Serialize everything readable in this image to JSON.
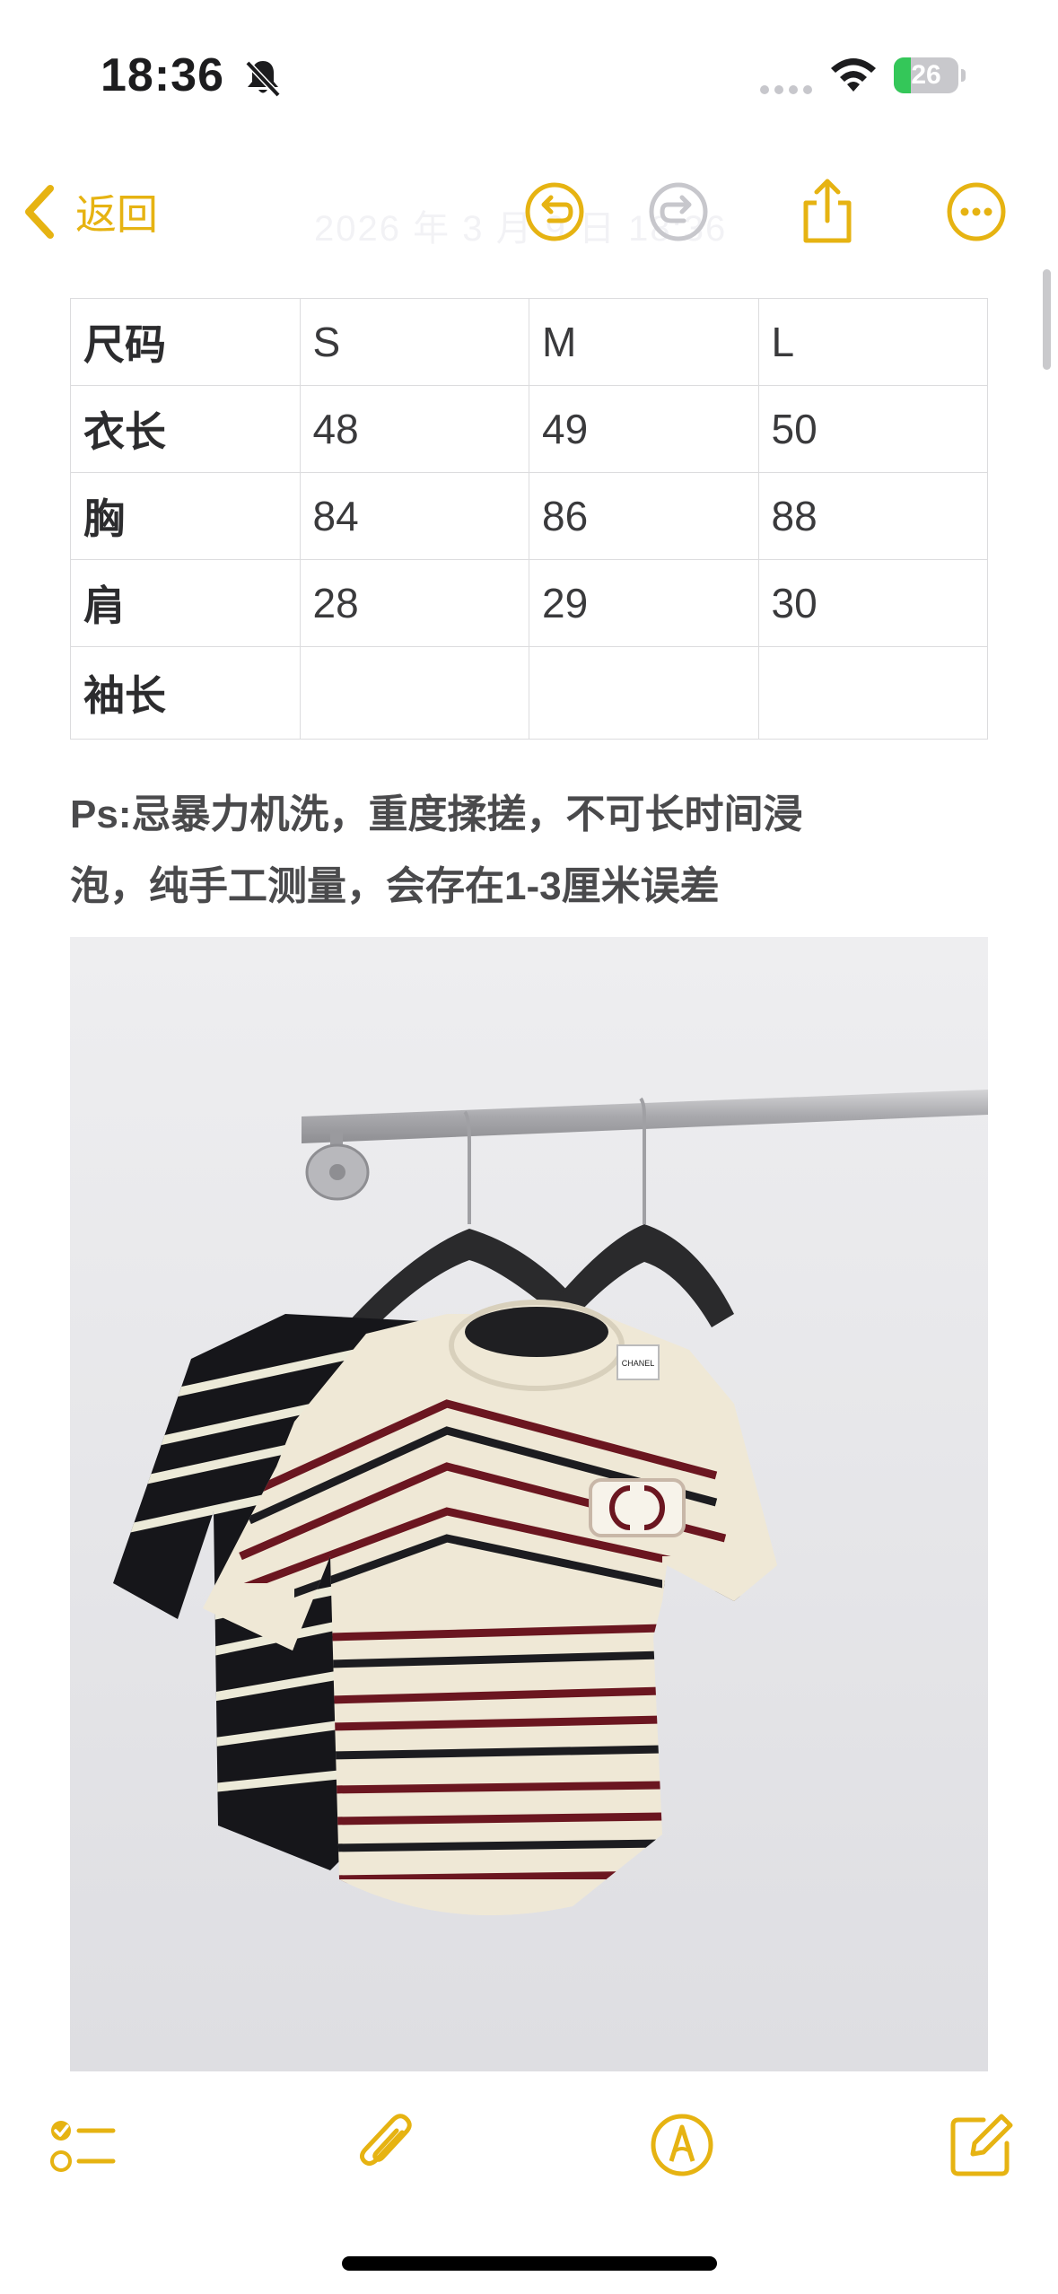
{
  "status_bar": {
    "time": "18:36",
    "battery_level": "26",
    "battery_fraction": 0.26,
    "icons": [
      "bell-slash-icon",
      "signal-dots-icon",
      "wifi-icon",
      "battery-charging-icon"
    ]
  },
  "nav": {
    "back_label": "返回",
    "date_faint": "2026 年 3 月 9 日 18:36",
    "icons": [
      "chevron-left-icon",
      "undo-icon",
      "redo-icon",
      "share-icon",
      "more-icon"
    ]
  },
  "size_table": {
    "rows": [
      [
        "尺码",
        "S",
        "M",
        "L"
      ],
      [
        "衣长",
        "48",
        "49",
        "50"
      ],
      [
        "胸",
        "84",
        "86",
        "88"
      ],
      [
        "肩",
        "28",
        "29",
        "30"
      ],
      [
        "袖长",
        "",
        "",
        ""
      ]
    ]
  },
  "note": {
    "line1": "Ps:忌暴力机洗，重度揉搓，不可长时间浸",
    "line2": "泡，纯手工测量，会存在1-3厘米误差"
  },
  "photo": {
    "description_icon": "photo-image",
    "label_text": "CHANEL"
  },
  "toolbar": {
    "icons": [
      "checklist-icon",
      "paperclip-icon",
      "markup-pen-icon",
      "compose-icon"
    ]
  },
  "colors": {
    "accent": "#e6b312",
    "disabled": "#c7c7cc",
    "text": "#1c1c1e",
    "table_border": "#dcdcde"
  }
}
